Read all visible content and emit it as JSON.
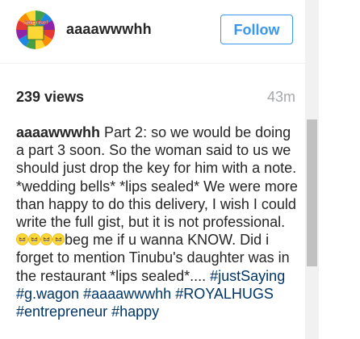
{
  "header": {
    "username": "aaaawwwhh",
    "follow_label": "Follow",
    "avatar": {
      "badge_text": "Surprise!",
      "colors": [
        "#e53935",
        "#fb8c00",
        "#fdd835",
        "#43a047",
        "#1e88e5",
        "#8e24aa"
      ]
    }
  },
  "stats": {
    "views": "239 views",
    "time": "43m"
  },
  "caption": {
    "username": "aaaawwwhh",
    "text_part1": " Part 2: so we would be doing a part 3 soon. So the woman said to us we should just drop the key for him with a note. *wedding bells* *lips sealed* We were more than happy to do this delivery, I wish I could write the full gist, but it is not professional. ",
    "emoji_name": "laughing-emoji",
    "emoji_count": 4,
    "text_part2": "beg me if u wanna KNOW. Did i forget to mention Tinubu's daughter was in the restaurant *lips sealed*.... ",
    "hashtags": [
      "#justSaying",
      "#g.wagon",
      "#aaaawwwhh",
      "#ROYALHUGS",
      "#entrepreneur",
      "#happy"
    ]
  },
  "colors": {
    "accent": "#3897f0",
    "hashtag": "#003569",
    "muted": "#a5a7aa",
    "text": "#262626"
  }
}
